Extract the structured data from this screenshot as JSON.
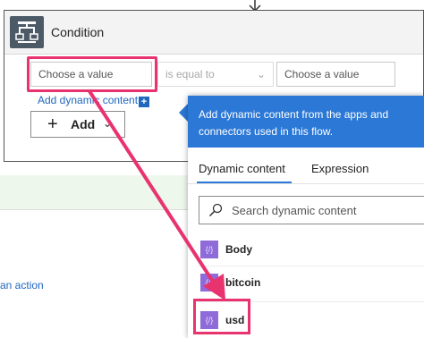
{
  "condition": {
    "title": "Condition",
    "left_value_placeholder": "Choose a value",
    "operator": "is equal to",
    "right_value_placeholder": "Choose a value",
    "add_dynamic_content": "Add dynamic content",
    "add_button_label": "Add"
  },
  "background": {
    "add_action_fragment": "an action"
  },
  "dynamic_panel": {
    "header_text": "Add dynamic content from the apps and connectors used in this flow.",
    "tabs": [
      {
        "label": "Dynamic content",
        "active": true
      },
      {
        "label": "Expression",
        "active": false
      }
    ],
    "search_placeholder": "Search dynamic content",
    "items": [
      {
        "label": "Body",
        "icon": "expression-icon"
      },
      {
        "label": "bitcoin",
        "icon": "expression-icon"
      },
      {
        "label": "usd",
        "icon": "expression-icon"
      }
    ]
  },
  "colors": {
    "accent_blue": "#2b78d6",
    "highlight_pink": "#e8336f",
    "item_icon_purple": "#8e6bd9",
    "condition_icon": "#4c5a68"
  }
}
